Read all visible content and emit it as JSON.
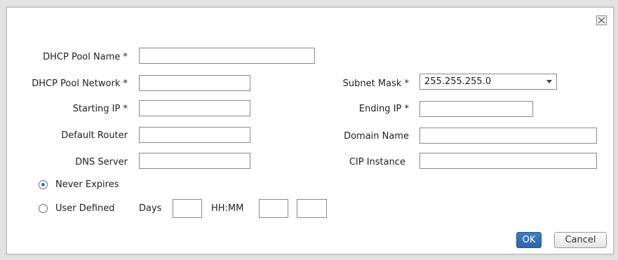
{
  "dialog": {
    "close_icon": "close-icon"
  },
  "form": {
    "pool_name_label": "DHCP Pool Name *",
    "pool_name_value": "",
    "pool_network_label": "DHCP Pool Network *",
    "pool_network_value": "",
    "subnet_mask_label": "Subnet Mask *",
    "subnet_mask_value": "255.255.255.0",
    "starting_ip_label": "Starting IP *",
    "starting_ip_value": "",
    "ending_ip_label": "Ending IP *",
    "ending_ip_value": "",
    "default_router_label": "Default Router",
    "default_router_value": "",
    "domain_name_label": "Domain Name",
    "domain_name_value": "",
    "dns_server_label": "DNS Server",
    "dns_server_value": "",
    "cip_instance_label": "CIP Instance",
    "cip_instance_value": ""
  },
  "lease": {
    "never_expires_label": "Never Expires",
    "never_expires_selected": true,
    "user_defined_label": "User Defined",
    "user_defined_selected": false,
    "days_label": "Days",
    "days_value": "",
    "hhmm_label": "HH:MM",
    "hours_value": "",
    "minutes_value": ""
  },
  "buttons": {
    "ok_label": "OK",
    "cancel_label": "Cancel"
  },
  "colors": {
    "accent": "#2f6db0",
    "dialog_background": "#ffffff",
    "page_background": "#e3e3e3"
  }
}
